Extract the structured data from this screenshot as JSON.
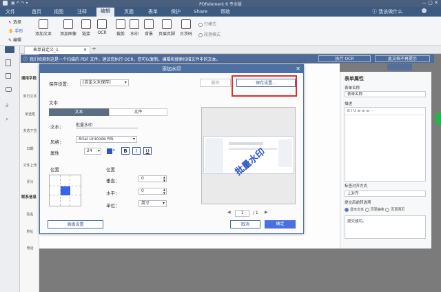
{
  "titlebar": {
    "title": "PDFelement 6 专业版"
  },
  "menubar": {
    "items": [
      "文件",
      "首页",
      "视图",
      "注释",
      "编辑",
      "页面",
      "表单",
      "保护",
      "Share",
      "帮助"
    ],
    "right_text": "ⓘ 我该做什么"
  },
  "tools": {
    "select": "选择",
    "hand": "手形",
    "edit": "编辑"
  },
  "ribbon": {
    "buttons": [
      "添加文本",
      "添加图像",
      "链接",
      "OCR",
      "裁剪",
      "水印",
      "背景",
      "页眉页脚",
      "贝茨码"
    ],
    "mode_line": "行模式",
    "mode_para": "段落模式"
  },
  "doc_tab": {
    "label": "表单自定义_1"
  },
  "ocr_bar": {
    "message": "我们检测到这是一个扫描的 PDF 文件，建议您执行 OCR，您可以复制、编辑和搜索扫描文件中的文本。",
    "run_ocr": "执行 OCR",
    "dismiss": "此文档不再提示"
  },
  "sidebar_left": {
    "items": [
      "通用字段",
      "单行文本",
      "单选框",
      "多选下拉",
      "日期",
      "文件上传",
      "评分",
      "联系信息",
      "姓名",
      "地址",
      "电话"
    ]
  },
  "right_panel": {
    "title": "表单属性",
    "name_label": "表单名称",
    "name_value": "表单名称",
    "desc_label": "描述",
    "align_label": "标签对齐方式",
    "align_value": "上对齐",
    "after_submit_label": "提交后前转选项",
    "opt1": "显示文本",
    "opt2": "页至抽奖",
    "opt3": "页至网页",
    "success_text": "提交成功。"
  },
  "dialog": {
    "title": "添加水印",
    "preset_label": "保存设置：",
    "preset_value": "[自定义未保存]",
    "delete_btn": "删除",
    "save_settings_btn": "保存设置...",
    "section_text": "文本",
    "tab_text": "文本",
    "tab_file": "文件",
    "text_label": "文本：",
    "text_value": "批量水印",
    "font_label": "风格：",
    "font_value": "Arial Unicode MS",
    "attr_label": "属性",
    "size_value": "24",
    "bold": "B",
    "italic": "I",
    "underline": "U",
    "position_left_title": "位置",
    "position_right_title": "位置",
    "vertical_label": "垂直：",
    "vertical_value": "0",
    "horizontal_label": "水平：",
    "horizontal_value": "0",
    "unit_label": "单位：",
    "unit_value": "英寸",
    "advanced_btn": "高级设置",
    "cancel_btn": "取消",
    "ok_btn": "确定",
    "watermark_preview_text": "批量水印",
    "page_current": "1",
    "page_total": "/ 1"
  },
  "colors": {
    "highlight_box": "#d9302c",
    "primary": "#4a6fe0",
    "title_bg": "#4d70a2"
  }
}
